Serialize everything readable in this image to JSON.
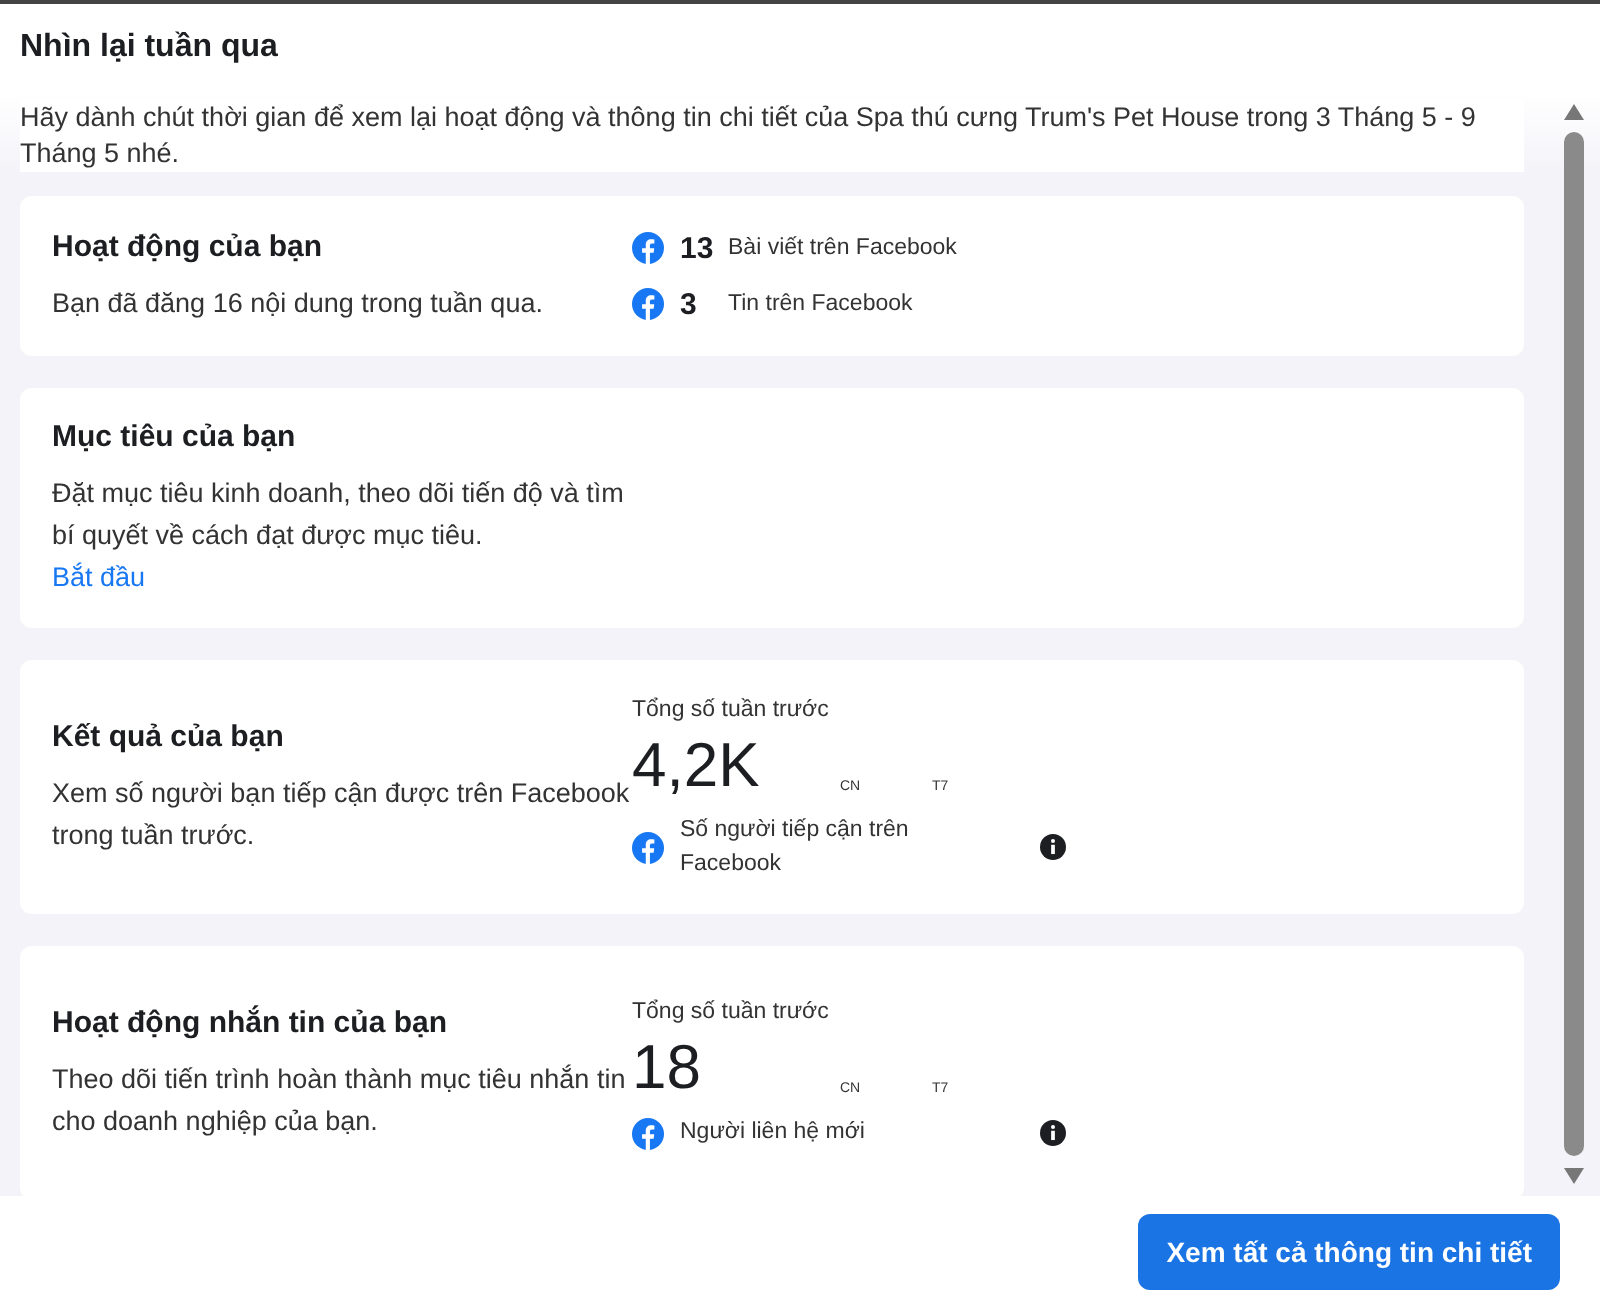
{
  "dialog": {
    "title": "Nhìn lại tuần qua",
    "intro": "Hãy dành chút thời gian để xem lại hoạt động và thông tin chi tiết của Spa thú cưng Trum's Pet House trong 3 Tháng 5 - 9 Tháng 5 nhé."
  },
  "cards": [
    {
      "kind": "stats",
      "title": "Hoạt động của bạn",
      "text": "Bạn đã đăng 16 nội dung trong tuần qua.",
      "stats": [
        {
          "value": "13",
          "label": "Bài viết trên Facebook"
        },
        {
          "value": "3",
          "label": "Tin trên Facebook"
        }
      ]
    },
    {
      "kind": "goal",
      "title": "Mục tiêu của bạn",
      "text": "Đặt mục tiêu kinh doanh, theo dõi tiến độ và tìm bí quyết về cách đạt được mục tiêu.",
      "link": "Bắt đầu"
    },
    {
      "kind": "metric",
      "title": "Kết quả của bạn",
      "text": "Xem số người bạn tiếp cận được trên Facebook trong tuần trước.",
      "total_label": "Tổng số tuần trước",
      "value": "4,2K",
      "axis": [
        "CN",
        "T7"
      ],
      "source": "Số người tiếp cận trên Facebook"
    },
    {
      "kind": "metric",
      "title": "Hoạt động nhắn tin của bạn",
      "text": "Theo dõi tiến trình hoàn thành mục tiêu nhắn tin cho doanh nghiệp của bạn.",
      "total_label": "Tổng số tuần trước",
      "value": "18",
      "axis": [
        "CN",
        "T7"
      ],
      "source": "Người liên hệ mới"
    }
  ],
  "footer": {
    "button": "Xem tất cả thông tin chi tiết"
  }
}
